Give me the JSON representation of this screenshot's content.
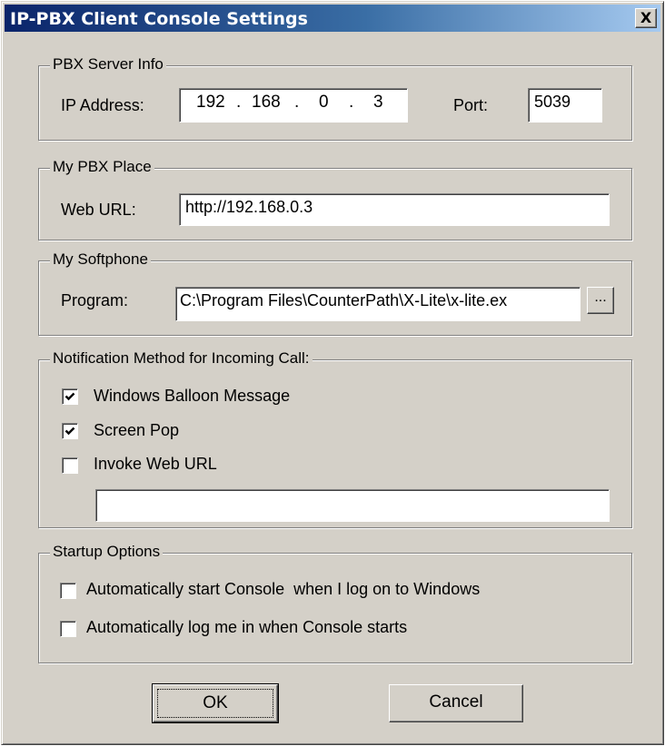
{
  "window": {
    "title": "IP-PBX Client Console Settings",
    "close_glyph": "X"
  },
  "server_info": {
    "legend": "PBX Server Info",
    "ip_label": "IP Address:",
    "ip_octets": [
      "192",
      "168",
      "0",
      "3"
    ],
    "ip_separator": ".",
    "port_label": "Port:",
    "port_value": "5039"
  },
  "pbx_place": {
    "legend": "My PBX Place",
    "url_label": "Web URL:",
    "url_value": "http://192.168.0.3"
  },
  "softphone": {
    "legend": "My Softphone",
    "program_label": "Program:",
    "program_value": "C:\\Program Files\\CounterPath\\X-Lite\\x-lite.ex",
    "browse_label": "..."
  },
  "notification": {
    "legend": "Notification Method for Incoming Call:",
    "options": [
      {
        "label": "Windows Balloon Message",
        "checked": true
      },
      {
        "label": "Screen Pop",
        "checked": true
      },
      {
        "label": "Invoke Web URL",
        "checked": false
      }
    ],
    "url_value": ""
  },
  "startup": {
    "legend": "Startup Options",
    "options": [
      {
        "label": "Automatically start Console  when I log on to Windows",
        "checked": false
      },
      {
        "label": "Automatically log me in when Console starts",
        "checked": false
      }
    ]
  },
  "buttons": {
    "ok": "OK",
    "cancel": "Cancel"
  },
  "icons": {
    "checkmark": "checkmark-icon",
    "close": "close-icon"
  }
}
